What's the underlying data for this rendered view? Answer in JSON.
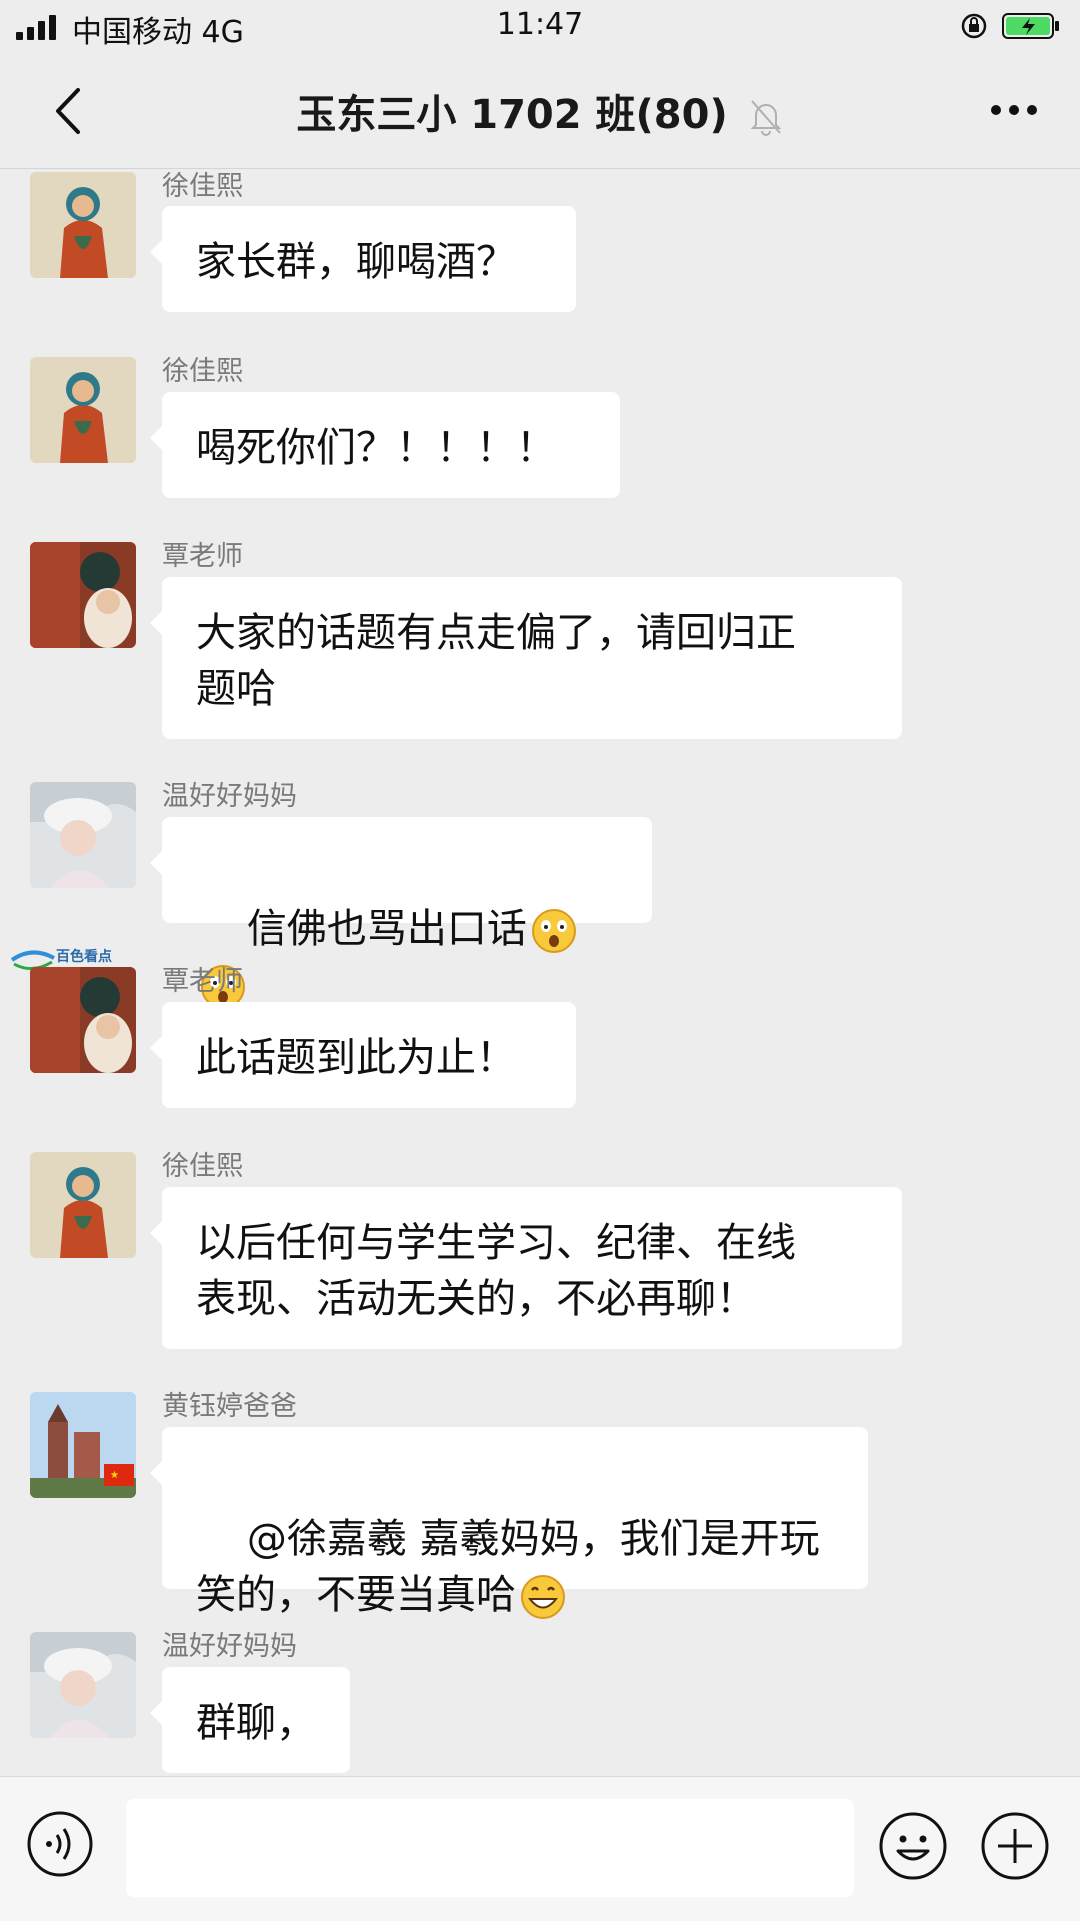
{
  "status": {
    "carrier": "中国移动 4G",
    "time": "11:47"
  },
  "nav": {
    "title": "玉东三小 1702 班(80)"
  },
  "messages": [
    {
      "sender": "徐佳熙",
      "text": "家长群，聊喝酒？",
      "avatar": "buddha"
    },
    {
      "sender": "徐佳熙",
      "text": "喝死你们？！！！！",
      "avatar": "buddha"
    },
    {
      "sender": "覃老师",
      "text": "大家的话题有点走偏了，请回归正\n题哈",
      "avatar": "teacher"
    },
    {
      "sender": "温好好妈妈",
      "text": "信佛也骂出口话",
      "avatar": "girl",
      "emojis": [
        "shocked-emoji",
        "shocked-emoji"
      ]
    },
    {
      "sender": "覃老师",
      "text": "此话题到此为止！",
      "avatar": "teacher"
    },
    {
      "sender": "徐佳熙",
      "text": "以后任何与学生学习、纪律、在线\n表现、活动无关的，不必再聊！",
      "avatar": "buddha"
    },
    {
      "sender": "黄钰婷爸爸",
      "text": "@徐嘉羲 嘉羲妈妈，我们是开玩\n笑的，不要当真哈",
      "avatar": "castle",
      "emojis": [
        "grin-emoji"
      ]
    },
    {
      "sender": "温好好妈妈",
      "text": "群聊，",
      "avatar": "girl"
    }
  ],
  "watermark": {
    "text": "百色看点"
  },
  "input": {
    "value": ""
  }
}
